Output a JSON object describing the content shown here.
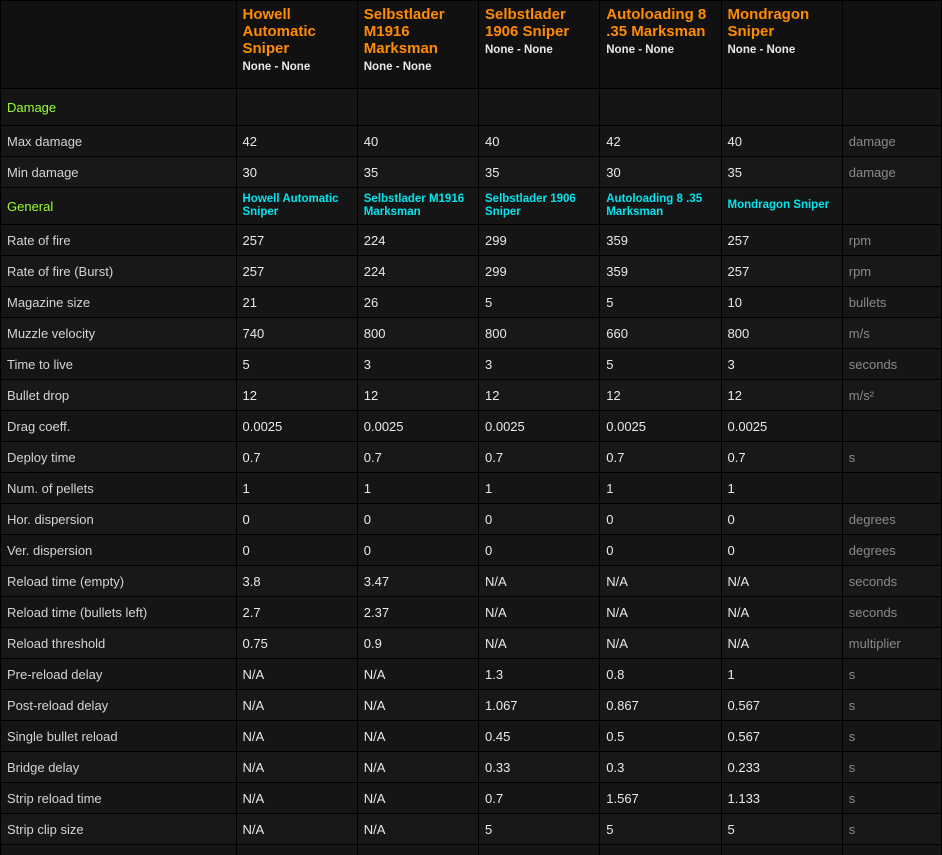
{
  "columns": [
    {
      "name": "Howell Automatic Sniper",
      "attachments": "None - None"
    },
    {
      "name": "Selbstlader M1916 Marksman",
      "attachments": "None - None"
    },
    {
      "name": "Selbstlader 1906 Sniper",
      "attachments": "None - None"
    },
    {
      "name": "Autoloading 8 .35 Marksman",
      "attachments": "None - None"
    },
    {
      "name": "Mondragon Sniper",
      "attachments": "None - None"
    }
  ],
  "sections": [
    {
      "title": "Damage",
      "subheaders": [
        "",
        "",
        "",
        "",
        ""
      ],
      "rows": [
        {
          "label": "Max damage",
          "values": [
            {
              "t": "42",
              "c": "v-ylgreen"
            },
            {
              "t": "40",
              "c": "v-red"
            },
            {
              "t": "40",
              "c": "v-red"
            },
            {
              "t": "42",
              "c": "v-ylgreen"
            },
            {
              "t": "40",
              "c": "v-red"
            }
          ],
          "unit": "damage"
        },
        {
          "label": "Min damage",
          "values": [
            {
              "t": "30",
              "c": "v-red"
            },
            {
              "t": "35",
              "c": "v-yellow"
            },
            {
              "t": "35",
              "c": "v-yellow"
            },
            {
              "t": "30",
              "c": "v-red"
            },
            {
              "t": "35",
              "c": "v-yellow"
            }
          ],
          "unit": "damage"
        }
      ]
    },
    {
      "title": "General",
      "subheaders": [
        "Howell Automatic Sniper",
        "Selbstlader M1916 Marksman",
        "Selbstlader 1906 Sniper",
        "Autoloading 8 .35 Marksman",
        "Mondragon Sniper"
      ],
      "rows": [
        {
          "label": "Rate of fire",
          "values": [
            {
              "t": "257",
              "c": "v-orange"
            },
            {
              "t": "224",
              "c": "v-red"
            },
            {
              "t": "299",
              "c": "v-ylgreen"
            },
            {
              "t": "359",
              "c": "v-green"
            },
            {
              "t": "257",
              "c": "v-orange"
            }
          ],
          "unit": "rpm"
        },
        {
          "label": "Rate of fire (Burst)",
          "values": [
            {
              "t": "257",
              "c": "v-orange"
            },
            {
              "t": "224",
              "c": "v-red"
            },
            {
              "t": "299",
              "c": "v-ylgreen"
            },
            {
              "t": "359",
              "c": "v-green"
            },
            {
              "t": "257",
              "c": "v-orange"
            }
          ],
          "unit": "rpm"
        },
        {
          "label": "Magazine size",
          "values": [
            {
              "t": "21",
              "c": "v-ylgreen"
            },
            {
              "t": "26",
              "c": "v-green"
            },
            {
              "t": "5",
              "c": "v-red"
            },
            {
              "t": "5",
              "c": "v-red"
            },
            {
              "t": "10",
              "c": "v-yellow"
            }
          ],
          "unit": "bullets"
        },
        {
          "label": "Muzzle velocity",
          "values": [
            {
              "t": "740",
              "c": "v-orange"
            },
            {
              "t": "800",
              "c": "v-yellow"
            },
            {
              "t": "800",
              "c": "v-yellow"
            },
            {
              "t": "660",
              "c": "v-red"
            },
            {
              "t": "800",
              "c": "v-yellow"
            }
          ],
          "unit": "m/s"
        },
        {
          "label": "Time to live",
          "values": [
            {
              "t": "5",
              "c": "v-ylgreen"
            },
            {
              "t": "3",
              "c": "v-red"
            },
            {
              "t": "3",
              "c": "v-red"
            },
            {
              "t": "5",
              "c": "v-ylgreen"
            },
            {
              "t": "3",
              "c": "v-red"
            }
          ],
          "unit": "seconds"
        },
        {
          "label": "Bullet drop",
          "values": [
            {
              "t": "12",
              "c": "v-plain"
            },
            {
              "t": "12",
              "c": "v-plain"
            },
            {
              "t": "12",
              "c": "v-plain"
            },
            {
              "t": "12",
              "c": "v-plain"
            },
            {
              "t": "12",
              "c": "v-plain"
            }
          ],
          "unit": "m/s²"
        },
        {
          "label": "Drag coeff.",
          "values": [
            {
              "t": "0.0025",
              "c": "v-plain"
            },
            {
              "t": "0.0025",
              "c": "v-plain"
            },
            {
              "t": "0.0025",
              "c": "v-plain"
            },
            {
              "t": "0.0025",
              "c": "v-plain"
            },
            {
              "t": "0.0025",
              "c": "v-plain"
            }
          ],
          "unit": ""
        },
        {
          "label": "Deploy time",
          "values": [
            {
              "t": "0.7",
              "c": "v-plain"
            },
            {
              "t": "0.7",
              "c": "v-plain"
            },
            {
              "t": "0.7",
              "c": "v-plain"
            },
            {
              "t": "0.7",
              "c": "v-plain"
            },
            {
              "t": "0.7",
              "c": "v-plain"
            }
          ],
          "unit": "s"
        },
        {
          "label": "Num. of pellets",
          "values": [
            {
              "t": "1",
              "c": "v-plain"
            },
            {
              "t": "1",
              "c": "v-plain"
            },
            {
              "t": "1",
              "c": "v-plain"
            },
            {
              "t": "1",
              "c": "v-plain"
            },
            {
              "t": "1",
              "c": "v-plain"
            }
          ],
          "unit": ""
        },
        {
          "label": "Hor. dispersion",
          "values": [
            {
              "t": "0",
              "c": "v-plain"
            },
            {
              "t": "0",
              "c": "v-plain"
            },
            {
              "t": "0",
              "c": "v-plain"
            },
            {
              "t": "0",
              "c": "v-plain"
            },
            {
              "t": "0",
              "c": "v-plain"
            }
          ],
          "unit": "degrees"
        },
        {
          "label": "Ver. dispersion",
          "values": [
            {
              "t": "0",
              "c": "v-plain"
            },
            {
              "t": "0",
              "c": "v-plain"
            },
            {
              "t": "0",
              "c": "v-plain"
            },
            {
              "t": "0",
              "c": "v-plain"
            },
            {
              "t": "0",
              "c": "v-plain"
            }
          ],
          "unit": "degrees"
        },
        {
          "label": "Reload time (empty)",
          "values": [
            {
              "t": "3.8",
              "c": "v-ylgreen"
            },
            {
              "t": "3.47",
              "c": "v-green"
            },
            {
              "t": "N/A",
              "c": "v-na"
            },
            {
              "t": "N/A",
              "c": "v-na"
            },
            {
              "t": "N/A",
              "c": "v-na"
            }
          ],
          "unit": "seconds"
        },
        {
          "label": "Reload time (bullets left)",
          "values": [
            {
              "t": "2.7",
              "c": "v-ylgreen"
            },
            {
              "t": "2.37",
              "c": "v-green"
            },
            {
              "t": "N/A",
              "c": "v-na"
            },
            {
              "t": "N/A",
              "c": "v-na"
            },
            {
              "t": "N/A",
              "c": "v-na"
            }
          ],
          "unit": "seconds"
        },
        {
          "label": "Reload threshold",
          "values": [
            {
              "t": "0.75",
              "c": "v-green"
            },
            {
              "t": "0.9",
              "c": "v-ylgreen"
            },
            {
              "t": "N/A",
              "c": "v-na"
            },
            {
              "t": "N/A",
              "c": "v-na"
            },
            {
              "t": "N/A",
              "c": "v-na"
            }
          ],
          "unit": "multiplier"
        },
        {
          "label": "Pre-reload delay",
          "values": [
            {
              "t": "N/A",
              "c": "v-na"
            },
            {
              "t": "N/A",
              "c": "v-na"
            },
            {
              "t": "1.3",
              "c": "v-yellow"
            },
            {
              "t": "0.8",
              "c": "v-green"
            },
            {
              "t": "1",
              "c": "v-ylgreen"
            }
          ],
          "unit": "s"
        },
        {
          "label": "Post-reload delay",
          "values": [
            {
              "t": "N/A",
              "c": "v-na"
            },
            {
              "t": "N/A",
              "c": "v-na"
            },
            {
              "t": "1.067",
              "c": "v-yellow"
            },
            {
              "t": "0.867",
              "c": "v-ylgreen"
            },
            {
              "t": "0.567",
              "c": "v-green"
            }
          ],
          "unit": "s"
        },
        {
          "label": "Single bullet reload",
          "values": [
            {
              "t": "N/A",
              "c": "v-na"
            },
            {
              "t": "N/A",
              "c": "v-na"
            },
            {
              "t": "0.45",
              "c": "v-green"
            },
            {
              "t": "0.5",
              "c": "v-ylgreen"
            },
            {
              "t": "0.567",
              "c": "v-yellow"
            }
          ],
          "unit": "s"
        },
        {
          "label": "Bridge delay",
          "values": [
            {
              "t": "N/A",
              "c": "v-na"
            },
            {
              "t": "N/A",
              "c": "v-na"
            },
            {
              "t": "0.33",
              "c": "v-yellow"
            },
            {
              "t": "0.3",
              "c": "v-ylgreen"
            },
            {
              "t": "0.233",
              "c": "v-green"
            }
          ],
          "unit": "s"
        },
        {
          "label": "Strip reload time",
          "values": [
            {
              "t": "N/A",
              "c": "v-na"
            },
            {
              "t": "N/A",
              "c": "v-na"
            },
            {
              "t": "0.7",
              "c": "v-green"
            },
            {
              "t": "1.567",
              "c": "v-yellow"
            },
            {
              "t": "1.133",
              "c": "v-ylgreen"
            }
          ],
          "unit": "s"
        },
        {
          "label": "Strip clip size",
          "values": [
            {
              "t": "N/A",
              "c": "v-na"
            },
            {
              "t": "N/A",
              "c": "v-na"
            },
            {
              "t": "5",
              "c": "v-red"
            },
            {
              "t": "5",
              "c": "v-red"
            },
            {
              "t": "5",
              "c": "v-red"
            }
          ],
          "unit": "s"
        }
      ]
    }
  ],
  "colors": {
    "weapon_title": "#ff8c00",
    "section_title": "#9aff2e",
    "subheader": "#00e5ee",
    "best": "#00e000",
    "good": "#aaff00",
    "mid": "#ffff00",
    "low": "#ff8c00",
    "worst": "#ff0000",
    "background": "#151515",
    "unit_text": "#8a8a8a"
  }
}
